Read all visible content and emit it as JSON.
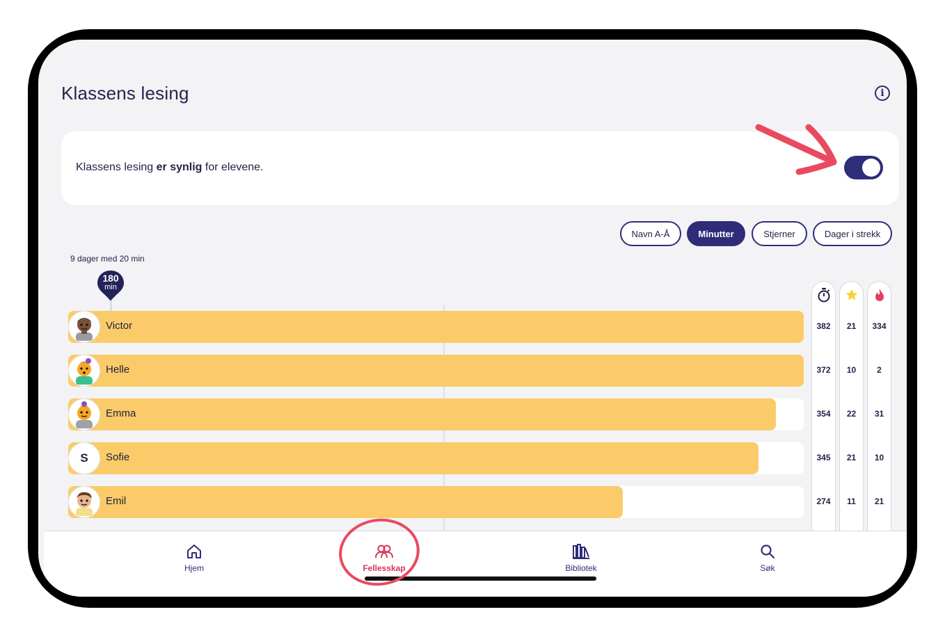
{
  "page": {
    "title": "Klassens lesing",
    "info_icon": "info-circle-icon"
  },
  "visibility": {
    "text_prefix": "Klassens lesing ",
    "text_bold": "er synlig",
    "text_suffix": " for elevene.",
    "toggle_on": true
  },
  "sort_buttons": [
    {
      "label": "Navn A-Å",
      "active": false
    },
    {
      "label": "Minutter",
      "active": true
    },
    {
      "label": "Stjerner",
      "active": false
    },
    {
      "label": "Dager i strekk",
      "active": false
    }
  ],
  "goal": {
    "label": "9 dager med 20 min",
    "marker_value": "180",
    "marker_unit": "min"
  },
  "stat_columns": [
    {
      "icon": "stopwatch-icon"
    },
    {
      "icon": "star-icon",
      "color": "#f5d233"
    },
    {
      "icon": "flame-icon",
      "color": "#e0405e"
    }
  ],
  "students": [
    {
      "name": "Victor",
      "avatar": "avatar-victor",
      "minutes": 382,
      "stars": 21,
      "streak": 334
    },
    {
      "name": "Helle",
      "avatar": "avatar-helle",
      "minutes": 372,
      "stars": 10,
      "streak": 2
    },
    {
      "name": "Emma",
      "avatar": "avatar-emma",
      "minutes": 354,
      "stars": 22,
      "streak": 31
    },
    {
      "name": "Sofie",
      "avatar_letter": "S",
      "minutes": 345,
      "stars": 21,
      "streak": 10
    },
    {
      "name": "Emil",
      "avatar": "avatar-emil",
      "minutes": 274,
      "stars": 11,
      "streak": 21
    }
  ],
  "tabbar": [
    {
      "label": "Hjem",
      "icon": "home-icon",
      "active": false
    },
    {
      "label": "Fellesskap",
      "icon": "community-icon",
      "active": true
    },
    {
      "label": "Bibliotek",
      "icon": "library-icon",
      "active": false
    },
    {
      "label": "Søk",
      "icon": "search-icon",
      "active": false
    }
  ],
  "colors": {
    "accent": "#2f2d78",
    "bar": "#fbcb69",
    "active_tab": "#d7345c",
    "annotation": "#e94a60"
  }
}
